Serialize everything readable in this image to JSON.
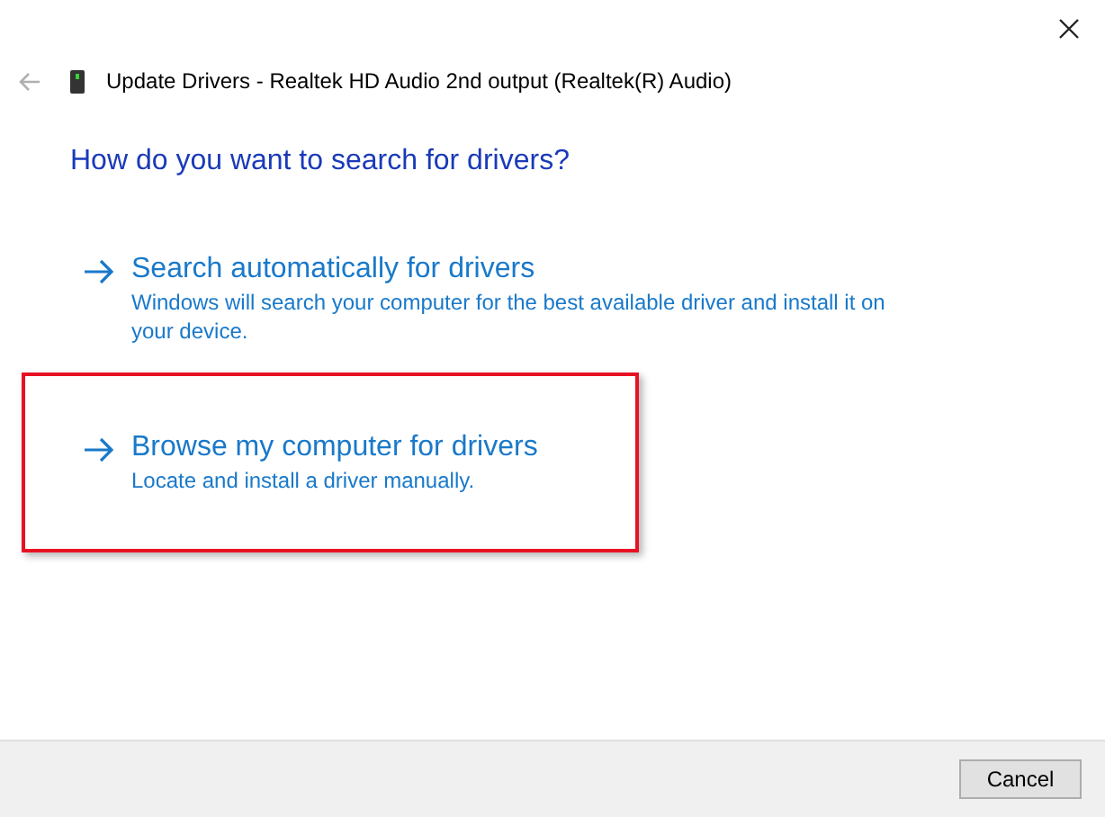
{
  "window": {
    "title": "Update Drivers - Realtek HD Audio 2nd output (Realtek(R) Audio)"
  },
  "heading": "How do you want to search for drivers?",
  "options": [
    {
      "title": "Search automatically for drivers",
      "description": "Windows will search your computer for the best available driver and install it on your device.",
      "highlighted": false
    },
    {
      "title": "Browse my computer for drivers",
      "description": "Locate and install a driver manually.",
      "highlighted": true
    }
  ],
  "buttons": [
    "Cancel"
  ]
}
